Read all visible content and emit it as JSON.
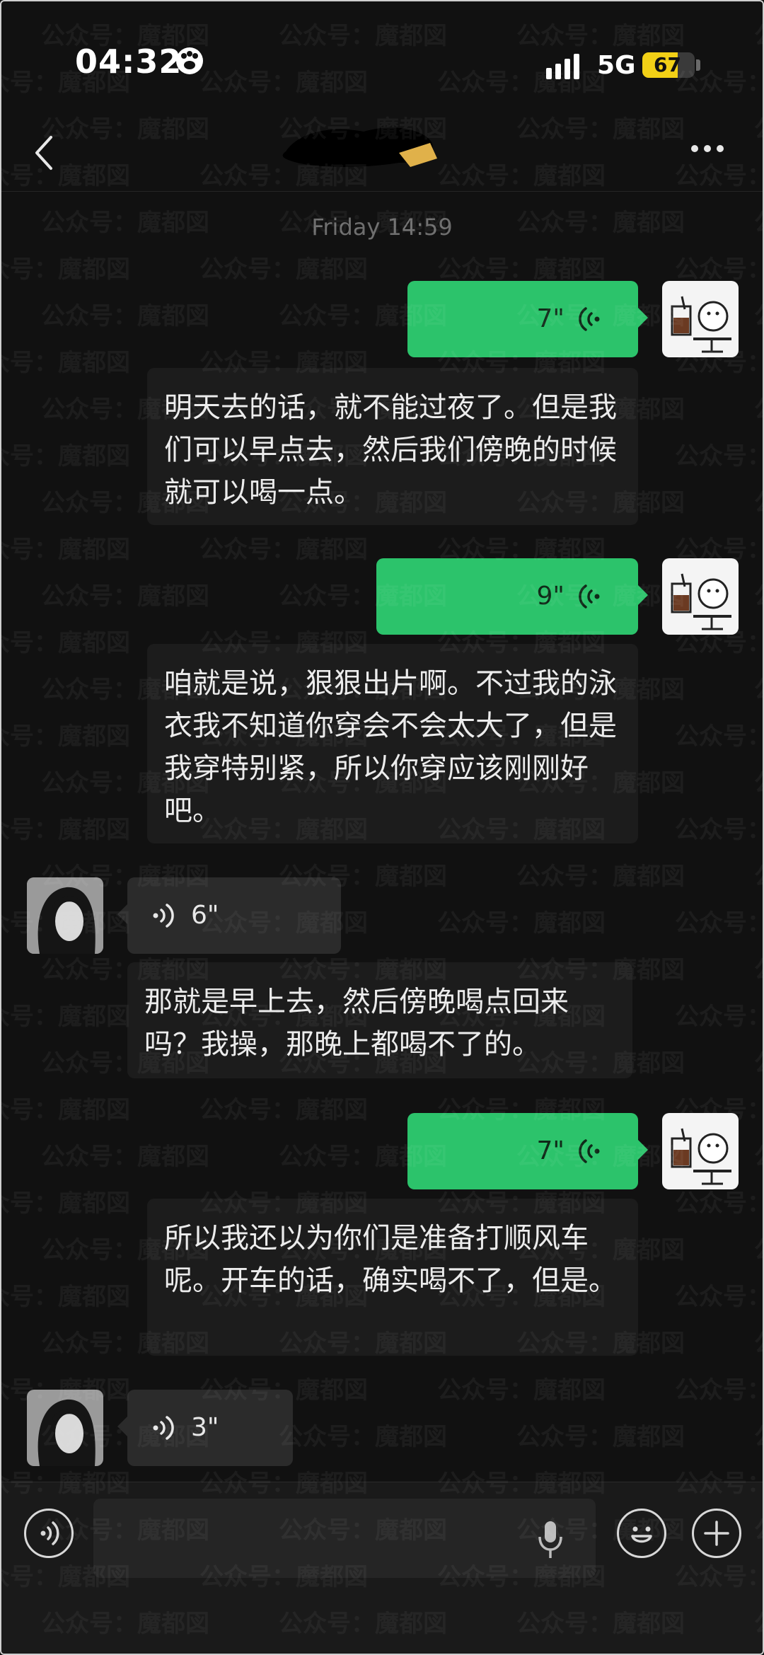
{
  "status_bar": {
    "time": "04:32",
    "network": "5G",
    "battery": "67",
    "battery_level": 0.67
  },
  "nav": {
    "back_icon": "chevron-left-icon",
    "more_icon": "more-dots-icon"
  },
  "chat": {
    "timestamp": "Friday 14:59",
    "messages": [
      {
        "sender": "me",
        "type": "voice",
        "duration": "7\"",
        "transcript": "明天去的话，就不能过夜了。但是我们可以早点去，然后我们傍晚的时候就可以喝一点。"
      },
      {
        "sender": "me",
        "type": "voice",
        "duration": "9\"",
        "transcript": "咱就是说，狠狠出片啊。不过我的泳衣我不知道你穿会不会太大了，但是我穿特别紧，所以你穿应该刚刚好吧。"
      },
      {
        "sender": "them",
        "type": "voice",
        "duration": "6\"",
        "transcript": "那就是早上去，然后傍晚喝点回来吗？我操，那晚上都喝不了的。"
      },
      {
        "sender": "me",
        "type": "voice",
        "duration": "7\"",
        "transcript": "所以我还以为你们是准备打顺风车呢。开车的话，确实喝不了，但是。"
      },
      {
        "sender": "them",
        "type": "voice",
        "duration": "3\""
      }
    ]
  },
  "input_bar": {
    "voice_icon": "voice-mode-icon",
    "mic_icon": "microphone-icon",
    "emoji_icon": "emoji-icon",
    "plus_icon": "plus-icon"
  },
  "watermark": "公众号：魔都図",
  "colors": {
    "background": "#111111",
    "my_bubble": "#2cc36b",
    "their_bubble": "#2b2b2b",
    "transcript_bg": "#1c1c1c",
    "battery": "#f2d016"
  }
}
